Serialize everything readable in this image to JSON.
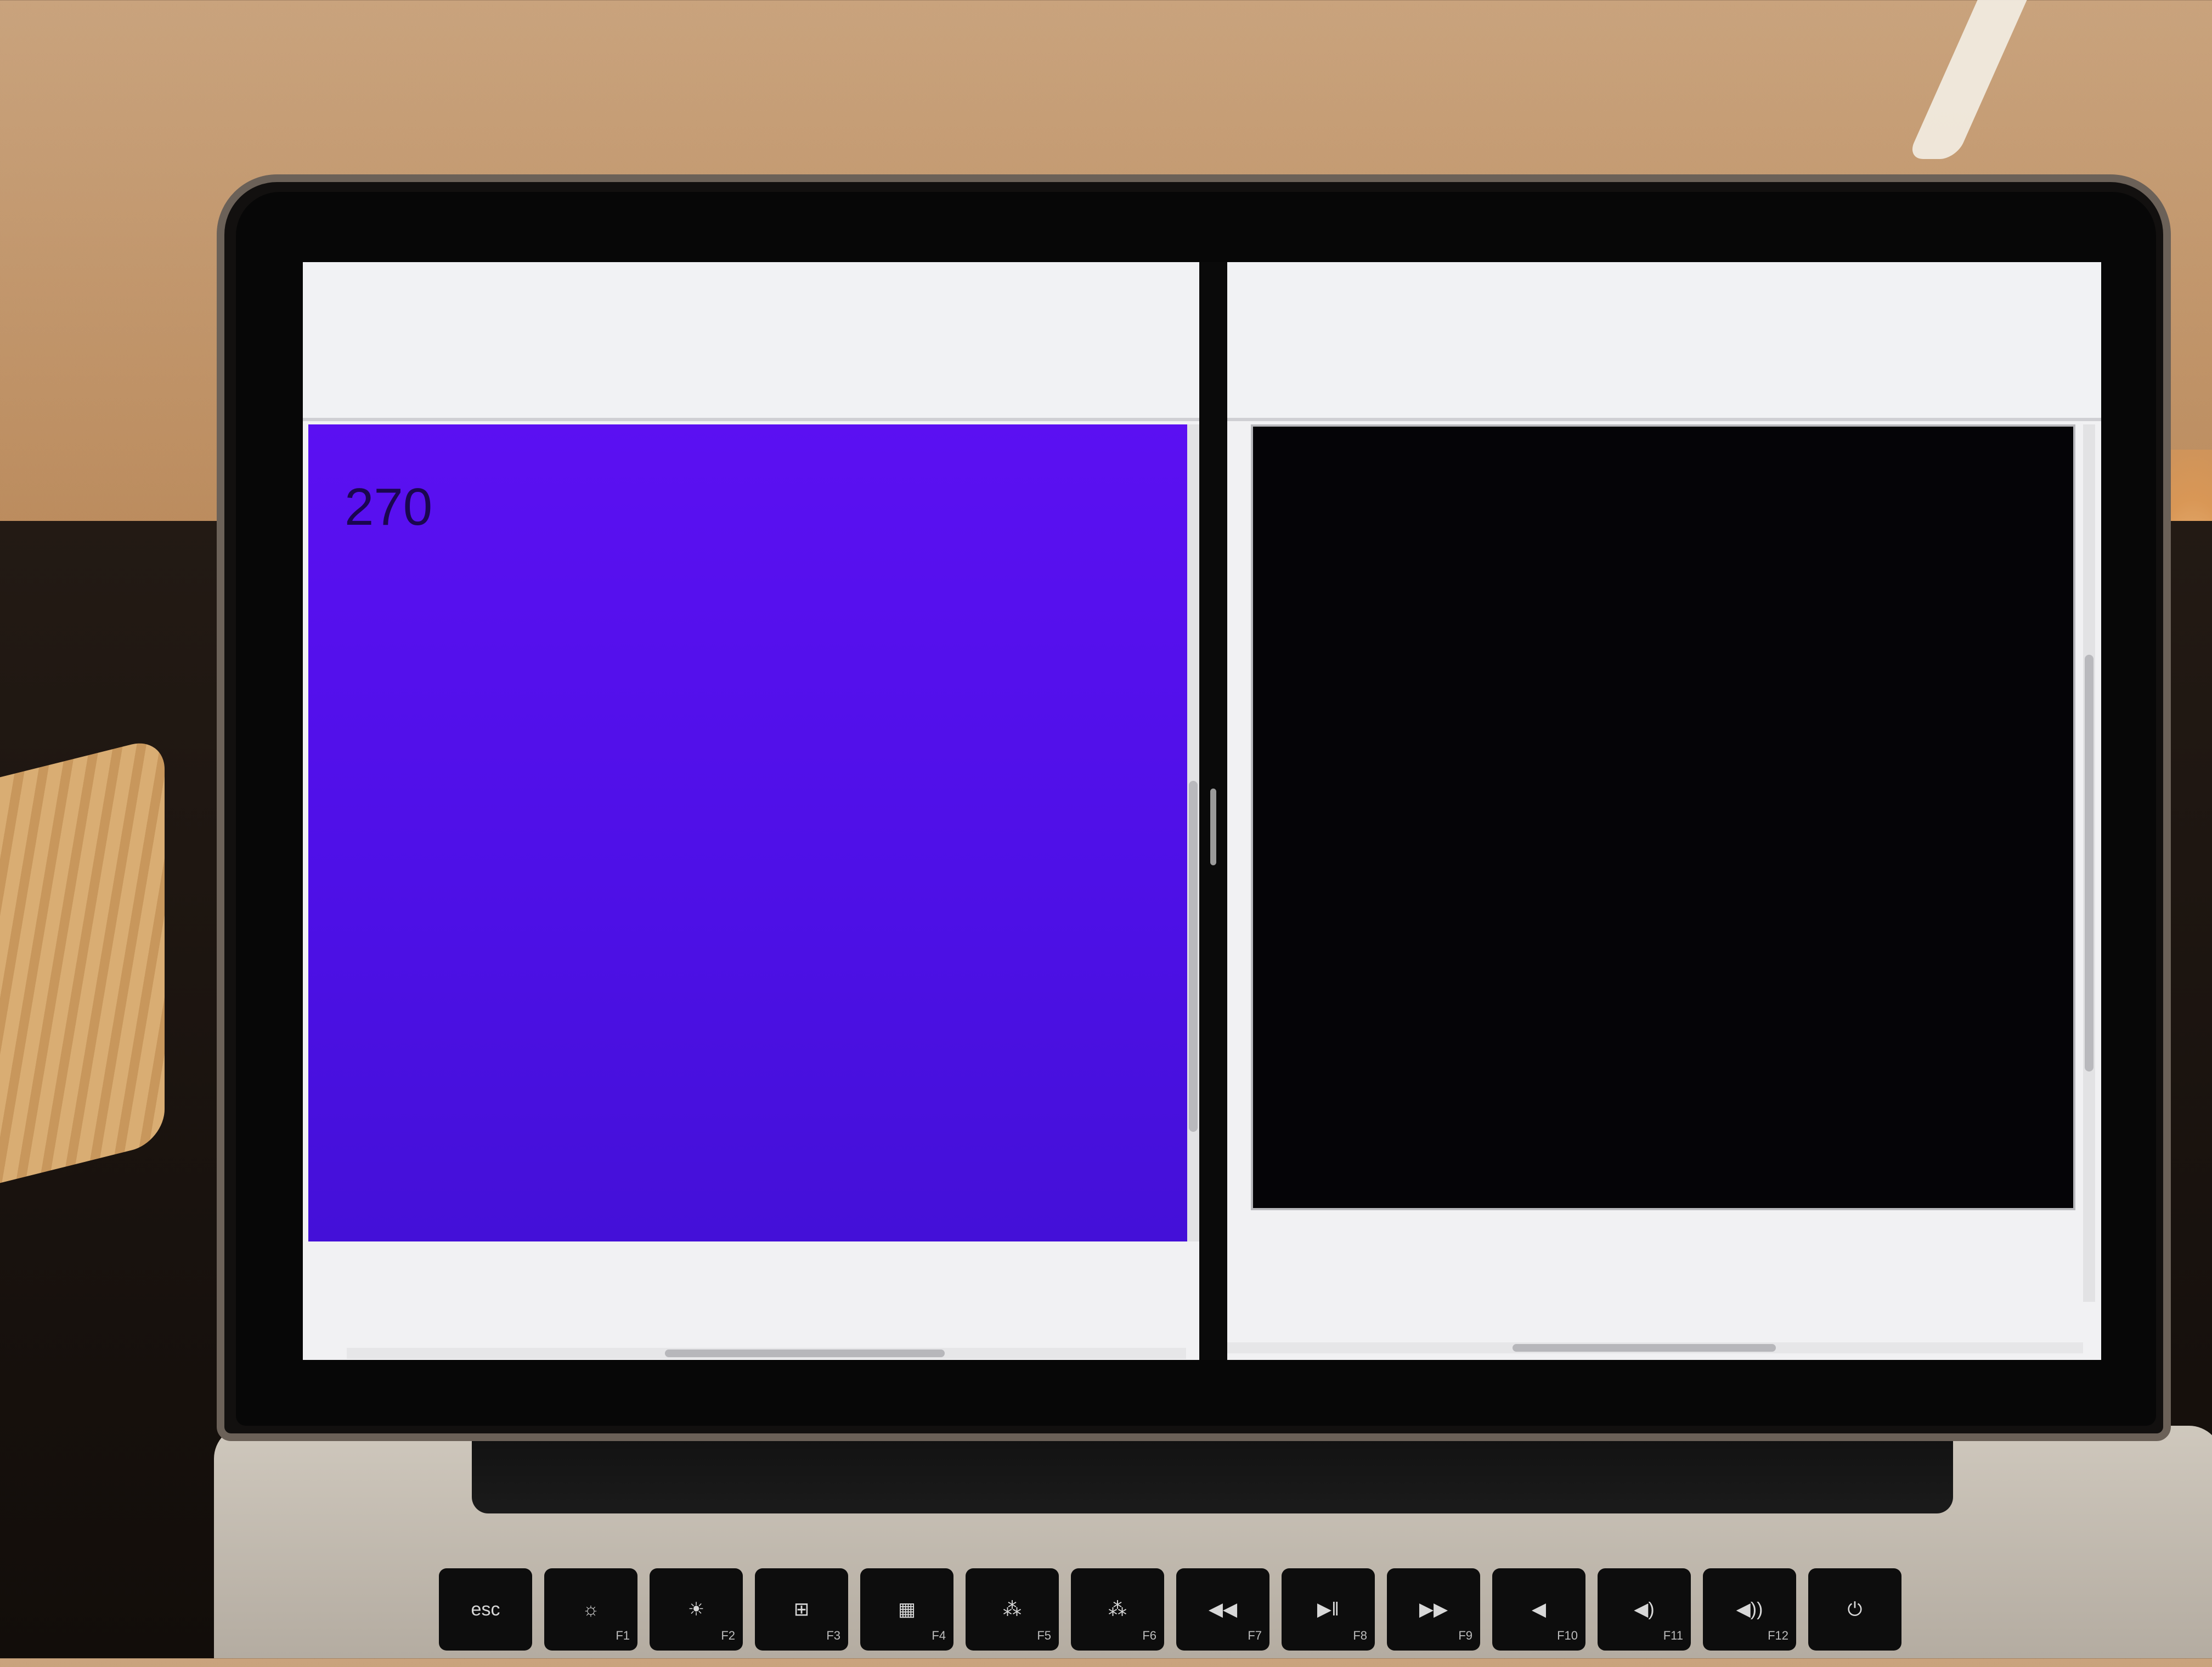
{
  "left_pane": {
    "value_text": "270",
    "canvas_color": "#5510ec"
  },
  "right_pane": {
    "canvas_color": "#050407"
  },
  "keyboard": {
    "keys": [
      {
        "label": "esc",
        "fn": ""
      },
      {
        "label": "☼",
        "fn": "F1"
      },
      {
        "label": "☀",
        "fn": "F2"
      },
      {
        "label": "⊞",
        "fn": "F3"
      },
      {
        "label": "▦",
        "fn": "F4"
      },
      {
        "label": "⁂",
        "fn": "F5"
      },
      {
        "label": "⁂",
        "fn": "F6"
      },
      {
        "label": "◀◀",
        "fn": "F7"
      },
      {
        "label": "▶‖",
        "fn": "F8"
      },
      {
        "label": "▶▶",
        "fn": "F9"
      },
      {
        "label": "◀",
        "fn": "F10"
      },
      {
        "label": "◀)",
        "fn": "F11"
      },
      {
        "label": "◀))",
        "fn": "F12"
      },
      {
        "label": "⏻",
        "fn": ""
      }
    ]
  }
}
